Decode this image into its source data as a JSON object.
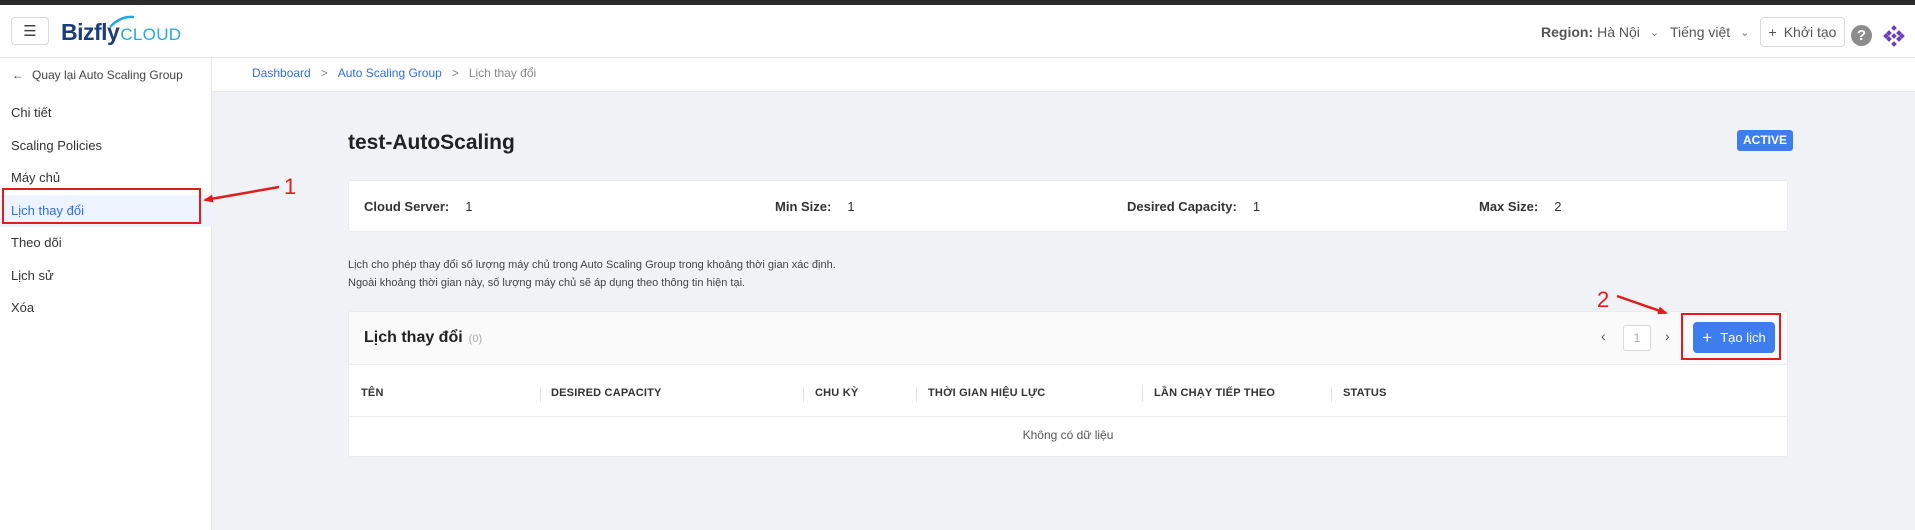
{
  "header": {
    "logo_main": "Bizfly",
    "logo_sub": "CLOUD",
    "region_label": "Region:",
    "region_value": "Hà Nội",
    "language": "Tiếng việt",
    "create_label": "Khởi tạo",
    "help_glyph": "?"
  },
  "sidebar": {
    "back_label": "Quay lại Auto Scaling Group",
    "items": [
      {
        "label": "Chi tiết",
        "active": false
      },
      {
        "label": "Scaling Policies",
        "active": false
      },
      {
        "label": "Máy chủ",
        "active": false
      },
      {
        "label": "Lịch thay đổi",
        "active": true
      },
      {
        "label": "Theo dõi",
        "active": false
      },
      {
        "label": "Lịch sử",
        "active": false
      },
      {
        "label": "Xóa",
        "active": false
      }
    ]
  },
  "breadcrumb": {
    "items": [
      "Dashboard",
      "Auto Scaling Group",
      "Lịch thay đổi"
    ],
    "separator": ">"
  },
  "page": {
    "title": "test-AutoScaling",
    "status": "ACTIVE"
  },
  "stats": {
    "cloud_server_label": "Cloud Server:",
    "cloud_server_value": "1",
    "min_size_label": "Min Size:",
    "min_size_value": "1",
    "desired_capacity_label": "Desired Capacity:",
    "desired_capacity_value": "1",
    "max_size_label": "Max Size:",
    "max_size_value": "2"
  },
  "description": {
    "line1": "Lịch cho phép thay đổi số lượng máy chủ trong Auto Scaling Group trong khoảng thời gian xác định.",
    "line2": "Ngoài khoảng thời gian này, số lượng máy chủ sẽ áp dụng theo thông tin hiện tại."
  },
  "schedule_panel": {
    "title": "Lịch thay đổi",
    "count": "(0)",
    "page_number": "1",
    "add_label": "Tạo lịch",
    "columns": [
      "TÊN",
      "DESIRED CAPACITY",
      "CHU KỲ",
      "THỜI GIAN HIỆU LỰC",
      "LẦN CHẠY TIẾP THEO",
      "STATUS"
    ],
    "empty_text": "Không có dữ liệu"
  },
  "annotations": {
    "marker_1": "1",
    "marker_2": "2"
  },
  "colors": {
    "primary": "#3d7dee",
    "link": "#2f6fe0",
    "annotation": "#e21b1b",
    "active_bg": "#eef4ff"
  }
}
